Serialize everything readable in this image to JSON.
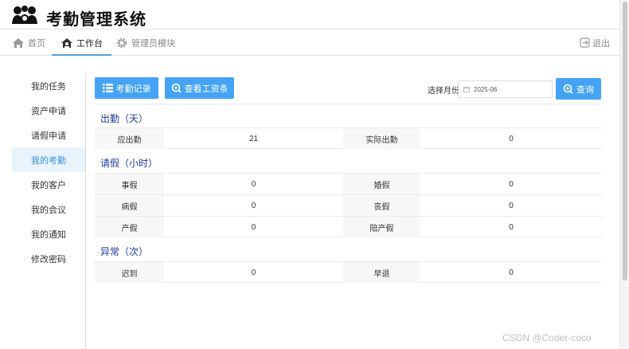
{
  "app": {
    "title": "考勤管理系统"
  },
  "nav": {
    "items": [
      {
        "label": "首页",
        "icon": "home-icon"
      },
      {
        "label": "工作台",
        "icon": "workbench-icon",
        "active": true
      },
      {
        "label": "管理员模块",
        "icon": "gear-icon"
      }
    ],
    "logout_label": "退出"
  },
  "sidebar": {
    "items": [
      {
        "label": "我的任务"
      },
      {
        "label": "资产申请"
      },
      {
        "label": "请假申请"
      },
      {
        "label": "我的考勤",
        "active": true
      },
      {
        "label": "我的客户"
      },
      {
        "label": "我的会议"
      },
      {
        "label": "我的通知"
      },
      {
        "label": "修改密码"
      }
    ]
  },
  "toolbar": {
    "records_label": "考勤记录",
    "salary_label": "查看工资条",
    "month_label": "选择月份",
    "month_value": "2025-06",
    "query_label": "查询"
  },
  "attendance": {
    "title": "出勤（天）",
    "rows": [
      {
        "l1": "应出勤",
        "v1": "21",
        "l2": "实际出勤",
        "v2": "0"
      }
    ]
  },
  "leave": {
    "title": "请假（小时）",
    "rows": [
      {
        "l1": "事假",
        "v1": "0",
        "l2": "婚假",
        "v2": "0"
      },
      {
        "l1": "病假",
        "v1": "0",
        "l2": "丧假",
        "v2": "0"
      },
      {
        "l1": "产假",
        "v1": "0",
        "l2": "陪产假",
        "v2": "0"
      }
    ]
  },
  "abnormal": {
    "title": "异常（次）",
    "rows": [
      {
        "l1": "迟到",
        "v1": "0",
        "l2": "早退",
        "v2": "0"
      }
    ]
  },
  "watermark": "CSDN @Coder-coco",
  "colors": {
    "accent": "#45a3f5",
    "section_title": "#1f3a9e",
    "active_bg": "#e8f3fc"
  }
}
